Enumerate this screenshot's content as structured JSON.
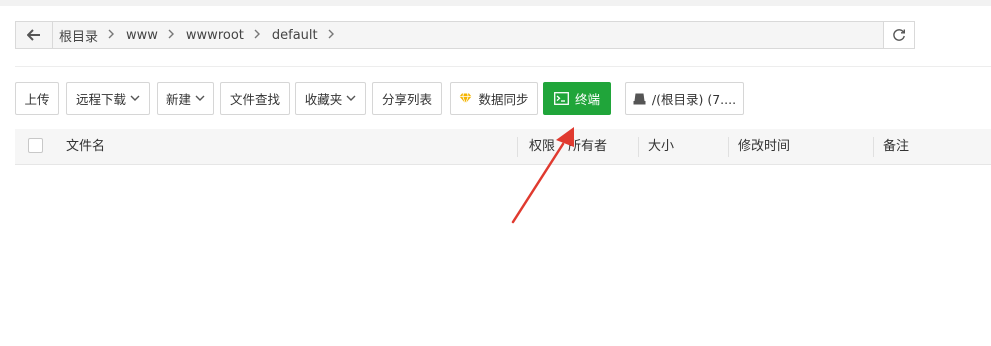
{
  "path": {
    "crumbs": [
      {
        "label": "根目录"
      },
      {
        "label": "www"
      },
      {
        "label": "wwwroot"
      },
      {
        "label": "default"
      }
    ]
  },
  "toolbar": {
    "upload": "上传",
    "remote_download": "远程下载",
    "new": "新建",
    "file_search": "文件查找",
    "favorites": "收藏夹",
    "share_list": "分享列表",
    "data_sync": "数据同步",
    "terminal": "终端",
    "disk": "/(根目录) (7...."
  },
  "table": {
    "columns": [
      "文件名",
      "权限",
      "所有者",
      "大小",
      "修改时间",
      "备注"
    ]
  },
  "colors": {
    "accent_green": "#20a53a",
    "annotation_arrow": "#e03a2f"
  }
}
